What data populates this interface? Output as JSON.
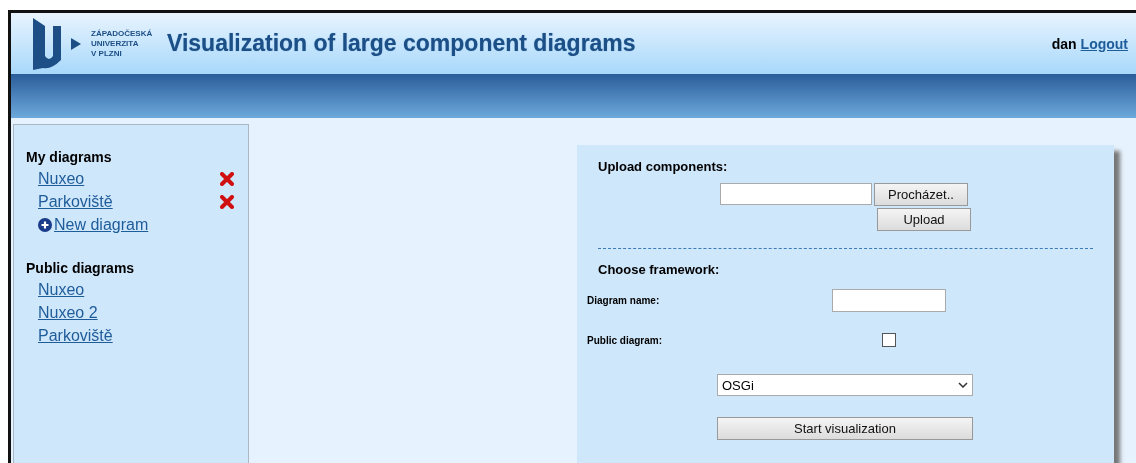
{
  "header": {
    "logo_lines": [
      "ZÁPADOČESKÁ",
      "UNIVERZITA",
      "V PLZNI"
    ],
    "title": "Visualization of large component diagrams",
    "user": "dan",
    "logout": "Logout"
  },
  "sidebar": {
    "sections": [
      {
        "title": "My diagrams",
        "items": [
          {
            "label": "Nuxeo",
            "deletable": true
          },
          {
            "label": "Parkoviště",
            "deletable": true
          }
        ],
        "new_link": "New diagram"
      },
      {
        "title": "Public diagrams",
        "items": [
          {
            "label": "Nuxeo",
            "deletable": false
          },
          {
            "label": "Nuxeo 2",
            "deletable": false
          },
          {
            "label": "Parkoviště",
            "deletable": false
          }
        ]
      }
    ]
  },
  "upload": {
    "title": "Upload components:",
    "browse_button": "Procházet..",
    "upload_button": "Upload"
  },
  "framework": {
    "title": "Choose framework:",
    "name_label": "Diagram name:",
    "public_label": "Public diagram:",
    "public_checked": false,
    "framework_value": "OSGi",
    "start_button": "Start visualization"
  }
}
